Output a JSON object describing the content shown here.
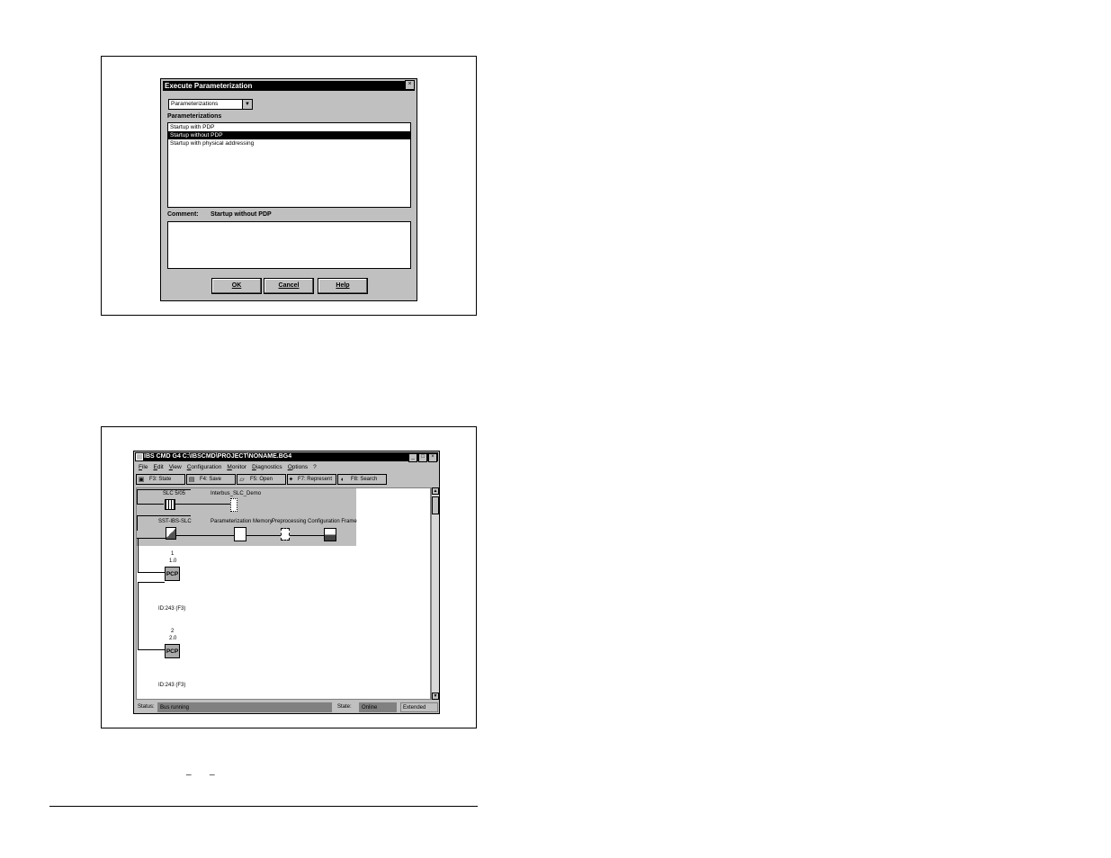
{
  "dialog": {
    "title": "Execute Parameterization",
    "close_glyph": "×",
    "combo_value": "Parameterizations",
    "combo_arrow": "▼",
    "list_label": "Parameterizations",
    "items": [
      {
        "label": "Startup with PDP",
        "selected": false
      },
      {
        "label": "Startup without PDP",
        "selected": true
      },
      {
        "label": "Startup with physical addressing",
        "selected": false
      }
    ],
    "comment_label": "Comment:",
    "comment_value": "Startup without PDP",
    "ok_label": "OK",
    "cancel_label": "Cancel",
    "help_label": "Help"
  },
  "app": {
    "title": "IBS CMD G4 C:\\IBSCMD\\PROJECT\\NONAME.BG4",
    "window_buttons": [
      "_",
      "□",
      "×"
    ],
    "menu": [
      "File",
      "Edit",
      "View",
      "Configuration",
      "Monitor",
      "Diagnostics",
      "Options",
      "?"
    ],
    "toolbar": [
      {
        "icon": "▣",
        "label": "F3: State",
        "icon_name": "state-icon"
      },
      {
        "icon": "▤",
        "label": "F4: Save",
        "icon_name": "save-icon"
      },
      {
        "icon": "▱",
        "label": "F5: Open",
        "icon_name": "open-folder-icon"
      },
      {
        "icon": "✦",
        "label": "F7: Represent",
        "icon_name": "represent-icon"
      },
      {
        "icon": "◐",
        "label": "F8: Search",
        "icon_name": "binoculars-icon"
      }
    ],
    "nodes": {
      "slc": "SLC 5/05",
      "interbus": "Interbus_SLC_Demo",
      "sst": "SST-IBS-SLC",
      "param_memory": "Parameterization Memory",
      "preprocessing": "Preprocessing",
      "config_frame": "Configuration Frame",
      "dev1_num": "1",
      "dev1_addr": "1.0",
      "dev1_type": "PCP",
      "dev1_id": "ID:243 (F3)",
      "dev2_num": "2",
      "dev2_addr": "2.0",
      "dev2_type": "PCP",
      "dev2_id": "ID:243 (F3)"
    },
    "scroll_up": "▲",
    "scroll_down": "▼",
    "status": {
      "label": "Status:",
      "value": "Bus running",
      "state_label": "State:",
      "state_value": "Online",
      "mode": "Extended"
    }
  },
  "page": {
    "footnote_marks": [
      "_",
      "_"
    ]
  }
}
